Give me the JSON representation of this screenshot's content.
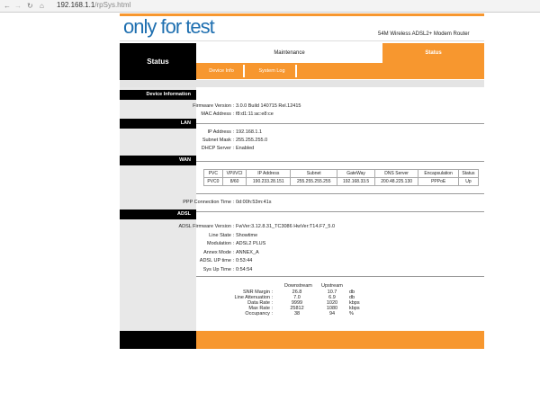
{
  "browser": {
    "url_host": "192.168.1.1",
    "url_path": "/rpSys.html"
  },
  "header": {
    "logo": "only for test",
    "product": "54M Wireless ADSL2+ Modem Router"
  },
  "nav": {
    "section": "Status",
    "maintenance": "Maintenance",
    "status_tab": "Status",
    "subtabs": [
      "Device Info",
      "System Log"
    ]
  },
  "device": {
    "title": "Device Information",
    "rows": [
      {
        "label": "Firmware Version :",
        "value": "3.0.0 Build 140715 Rel.12415"
      },
      {
        "label": "MAC Address :",
        "value": "f8:d1:11:ac:e8:ce"
      }
    ]
  },
  "lan": {
    "title": "LAN",
    "rows": [
      {
        "label": "IP Address :",
        "value": "192.168.1.1"
      },
      {
        "label": "Subnet Mask :",
        "value": "255.255.255.0"
      },
      {
        "label": "DHCP Server :",
        "value": "Enabled"
      }
    ]
  },
  "wan": {
    "title": "WAN",
    "headers": [
      "PVC",
      "VPI/VCI",
      "IP Address",
      "Subnet",
      "GateWay",
      "DNS Server",
      "Encapsulation",
      "Status"
    ],
    "row": [
      "PVC0",
      "8/60",
      "190.233.28.151",
      "255.255.255.255",
      "192.168.33.5",
      "200.48.225.130",
      "PPPoE",
      "Up"
    ],
    "ppp_label": "PPP Connection Time :",
    "ppp_value": "0d:00h:53m:41s"
  },
  "adsl": {
    "title": "ADSL",
    "rows": [
      {
        "label": "ADSL Firmware Version :",
        "value": "FwVer:3.12.8.31_TC3086 HwVer:T14.F7_5.0"
      },
      {
        "label": "Line State :",
        "value": "Showtime"
      },
      {
        "label": "Modulation :",
        "value": "ADSL2 PLUS"
      },
      {
        "label": "Annex Mode :",
        "value": "ANNEX_A"
      },
      {
        "label": "ADSL UP time :",
        "value": "0:53:44"
      },
      {
        "label": "Sys Up Time :",
        "value": "0:54:54"
      }
    ],
    "stats_headers": [
      "Downstream",
      "Upstream"
    ],
    "stats": [
      {
        "label": "SNR Margin :",
        "down": "26.8",
        "up": "10.7",
        "unit": "db"
      },
      {
        "label": "Line Attenuation :",
        "down": "7.0",
        "up": "6.9",
        "unit": "db"
      },
      {
        "label": "Data Rate :",
        "down": "9999",
        "up": "1020",
        "unit": "kbps"
      },
      {
        "label": "Max Rate :",
        "down": "25812",
        "up": "1080",
        "unit": "kbps"
      },
      {
        "label": "Occupancy :",
        "down": "38",
        "up": "94",
        "unit": "%"
      }
    ]
  },
  "colors": {
    "orange": "#f7972f",
    "black": "#000000",
    "logo": "#1e6fb0"
  }
}
